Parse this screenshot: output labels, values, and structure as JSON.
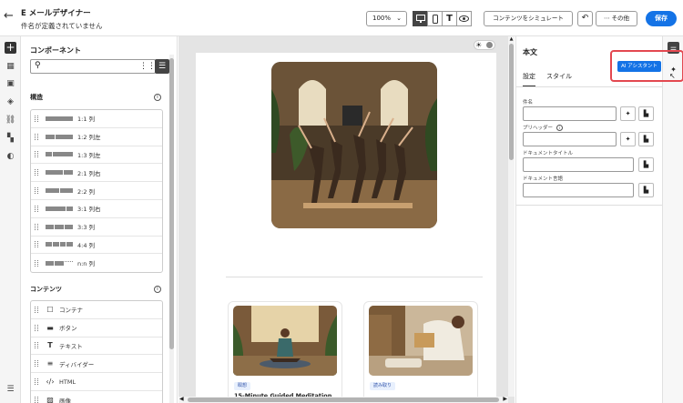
{
  "header": {
    "title": "E メールデザイナー",
    "subtitle": "件名が定義されていません",
    "zoom": "100%",
    "simulate_label": "コンテンツをシミュレート",
    "more_label": "その他",
    "save_label": "保存"
  },
  "left_panel": {
    "title": "コンポーネント",
    "structure_header": "構造",
    "structure_items": [
      "1:1 列",
      "1:2 列左",
      "1:3 列左",
      "2:1 列右",
      "2:2 列",
      "3:1 列右",
      "3:3 列",
      "4:4 列",
      "n:n 列"
    ],
    "content_header": "コンテンツ",
    "content_items": [
      "コンテナ",
      "ボタン",
      "テキスト",
      "ディバイダー",
      "HTML",
      "画像"
    ]
  },
  "canvas": {
    "cards": [
      {
        "tag": "瞑想",
        "title": "15-Minute Guided Meditation"
      },
      {
        "tag": "読み取り",
        "title": ""
      }
    ]
  },
  "right_panel": {
    "title": "本文",
    "tabs": [
      "設定",
      "スタイル"
    ],
    "fields": [
      {
        "label": "件名"
      },
      {
        "label": "プリヘッダー"
      },
      {
        "label": "ドキュメントタイトル"
      },
      {
        "label": "ドキュメント言語"
      }
    ],
    "ai_label": "AI アシスタント"
  },
  "colors": {
    "accent": "#1473e6",
    "highlight": "#e34850"
  }
}
